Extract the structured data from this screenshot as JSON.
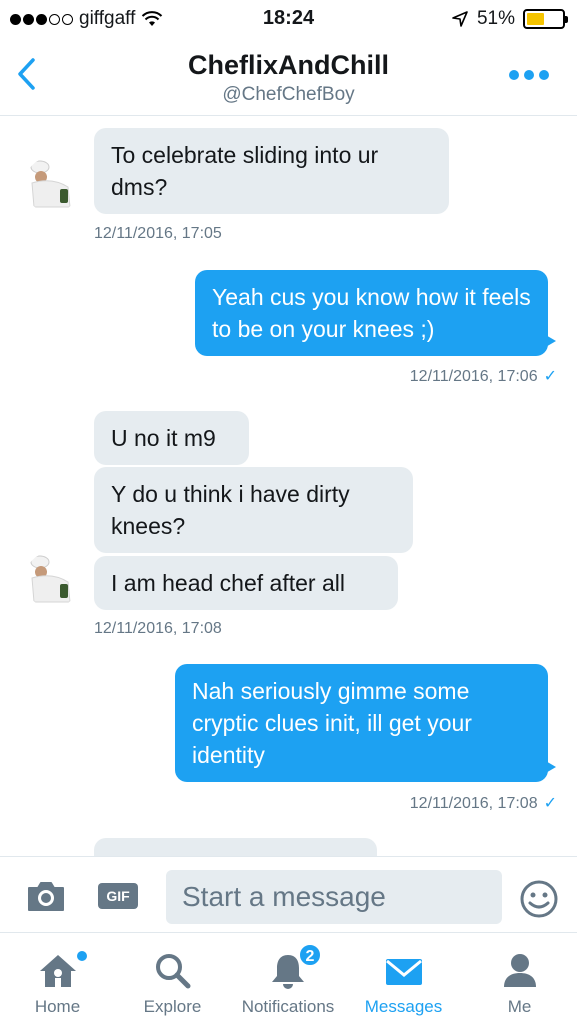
{
  "status_bar": {
    "carrier": "giffgaff",
    "time": "18:24",
    "battery": "51%",
    "battery_level": 0.51
  },
  "header": {
    "title": "CheflixAndChill",
    "handle": "@ChefChefBoy"
  },
  "messages": [
    {
      "direction": "in",
      "text": "To celebrate sliding into ur dms?"
    },
    {
      "direction": "in",
      "timestamp": "12/11/2016, 17:05"
    },
    {
      "direction": "out",
      "text": "Yeah cus you know how it feels to be on your knees ;)",
      "timestamp": "12/11/2016, 17:06",
      "status_icon": "✓"
    },
    {
      "direction": "in",
      "text": "U no it m9"
    },
    {
      "direction": "in",
      "text": "Y do u think i have dirty knees?"
    },
    {
      "direction": "in",
      "text": "I am head chef after all",
      "timestamp": "12/11/2016, 17:08"
    },
    {
      "direction": "out",
      "text": "Nah seriously gimme some cryptic clues init, ill get your identity",
      "timestamp": "12/11/2016, 17:08",
      "status_icon": "✓"
    }
  ],
  "composer": {
    "gif_label": "GIF",
    "placeholder": "Start a message"
  },
  "tabs": [
    {
      "label": "Home",
      "icon": "home-icon",
      "has_dot": true
    },
    {
      "label": "Explore",
      "icon": "search-icon"
    },
    {
      "label": "Notifications",
      "icon": "bell-icon",
      "badge": "2"
    },
    {
      "label": "Messages",
      "icon": "envelope-icon",
      "active": true
    },
    {
      "label": "Me",
      "icon": "person-icon"
    }
  ],
  "colors": {
    "accent": "#1da1f2",
    "incoming_bubble": "#e6ecf0",
    "muted": "#657786",
    "battery": "#f5c400"
  }
}
